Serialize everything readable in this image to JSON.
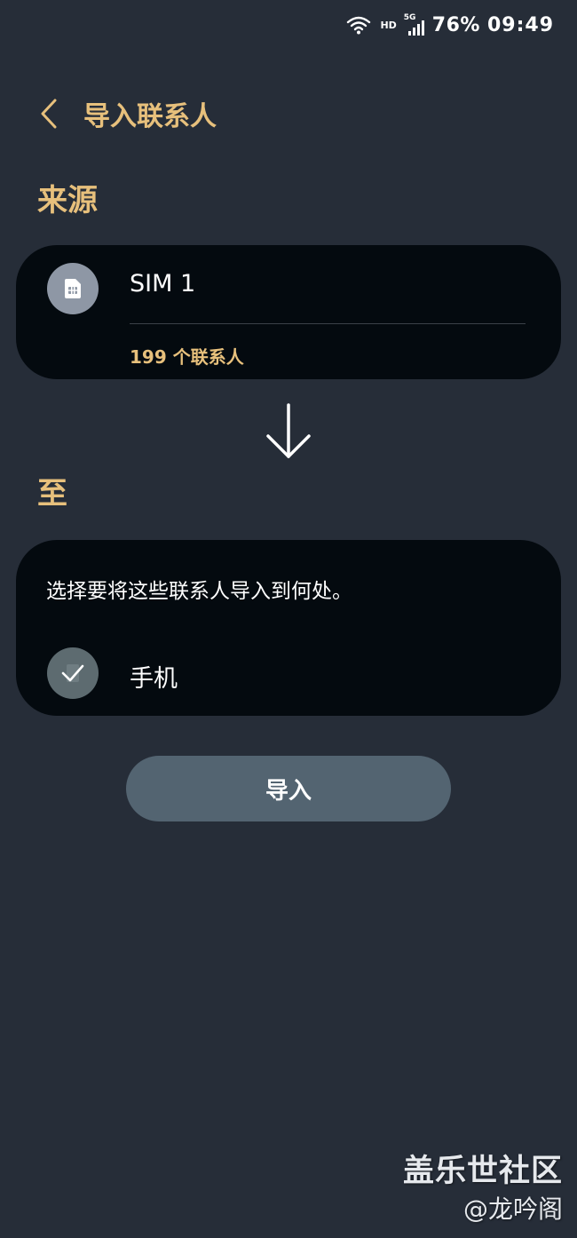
{
  "status_bar": {
    "network_label": "HD",
    "network_type": "5G",
    "battery": "76%",
    "time": "09:49",
    "icons": [
      "wifi-icon",
      "signal-icon"
    ]
  },
  "header": {
    "back_icon": "chevron-left-icon",
    "title": "导入联系人"
  },
  "source_section": {
    "title": "来源",
    "source": {
      "icon": "sim-card-icon",
      "name": "SIM 1",
      "contact_count": "199 个联系人"
    }
  },
  "transfer_icon": "arrow-down-icon",
  "target_section": {
    "title": "至",
    "prompt": "选择要将这些联系人导入到何处。",
    "destination": {
      "icon": "checkmark-icon",
      "label": "手机",
      "checked": true
    }
  },
  "import_button": {
    "label": "导入"
  },
  "watermark": {
    "title": "盖乐世社区",
    "author": "@龙吟阁"
  },
  "colors": {
    "background": "#262d38",
    "card": "#040a0f",
    "accent": "#e7c07c",
    "button": "#536471",
    "sim_avatar": "#8e97a5",
    "check_circle": "#5d6b70"
  }
}
